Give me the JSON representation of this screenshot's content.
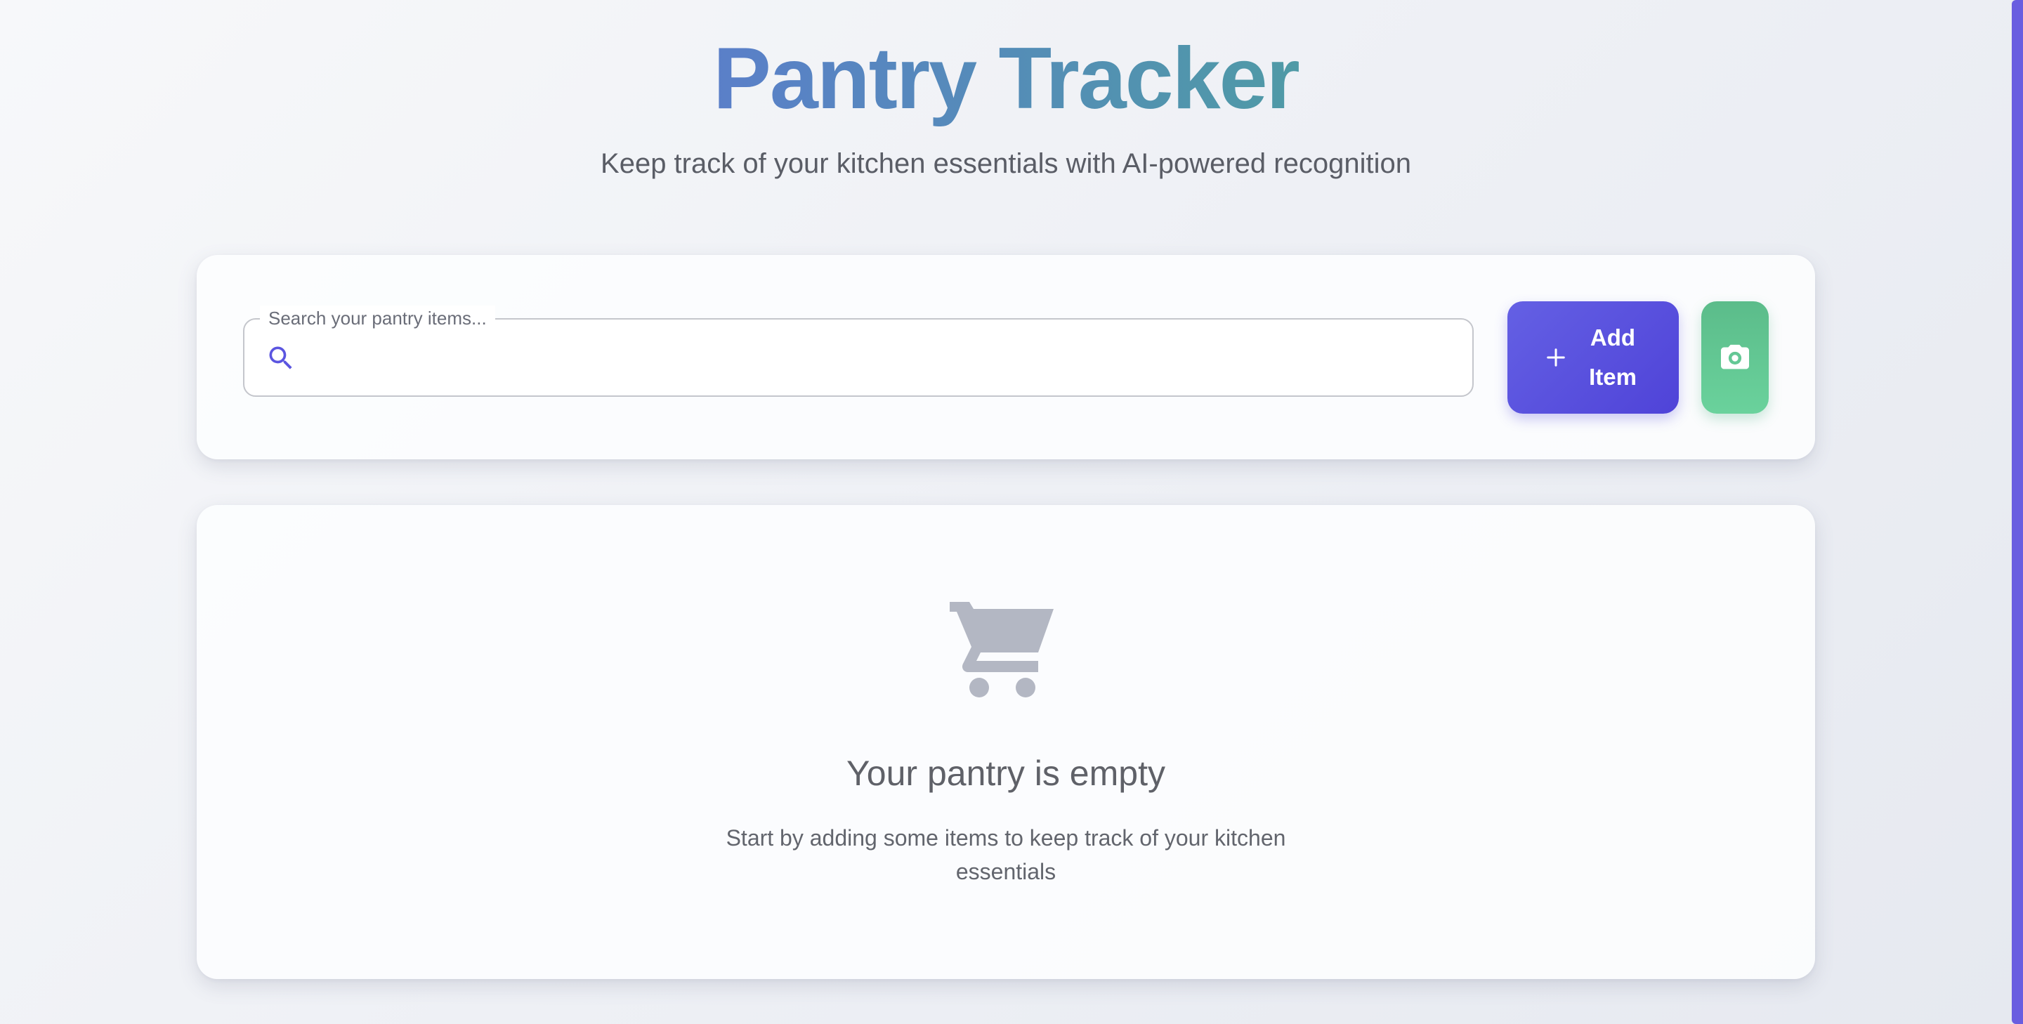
{
  "app": {
    "title": "Pantry Tracker",
    "subtitle": "Keep track of your kitchen essentials with AI-powered recognition"
  },
  "search": {
    "label": "Search your pantry items...",
    "value": "",
    "icon": "search-icon"
  },
  "actions": {
    "add_label": "Add Item",
    "add_icon": "plus-icon",
    "camera_icon": "camera-icon"
  },
  "empty_state": {
    "icon": "shopping-cart-icon",
    "title": "Your pantry is empty",
    "description": "Start by adding some items to keep track of your kitchen essentials"
  },
  "colors": {
    "accent": "#5a52e0",
    "camera": "#62c794",
    "title_gradient_start": "#5a7fc9",
    "title_gradient_end": "#4f9aa6",
    "empty_icon": "#b3b7c3"
  }
}
